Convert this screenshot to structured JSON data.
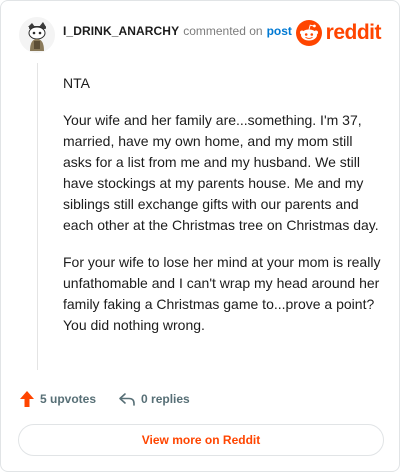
{
  "header": {
    "username": "I_DRINK_ANARCHY",
    "commented_text": "commented on",
    "post_link": "post",
    "brand": "reddit"
  },
  "comment": {
    "paragraphs": [
      "NTA",
      "Your wife and her family are...something. I'm 37, married, have my own home, and my mom still asks for a list from me and my husband. We still have stockings at my parents house. Me and my siblings still exchange gifts with our parents and each other at the Christmas tree on Christmas day.",
      "For your wife to lose her mind at your mom is really unfathomable and I can't wrap my head around her family faking a Christmas game to...prove a point? You did nothing wrong."
    ]
  },
  "actions": {
    "upvotes": "5 upvotes",
    "replies": "0 replies"
  },
  "footer": {
    "view_more": "View more on Reddit"
  },
  "colors": {
    "accent": "#ff4500",
    "link": "#0079d3",
    "muted": "#7c7c7c",
    "text": "#1c1c1c"
  },
  "icons": {
    "avatar": "snoo-avatar",
    "brand": "reddit-snoo-icon",
    "upvote": "upvote-arrow-icon",
    "reply": "reply-arrow-icon"
  }
}
